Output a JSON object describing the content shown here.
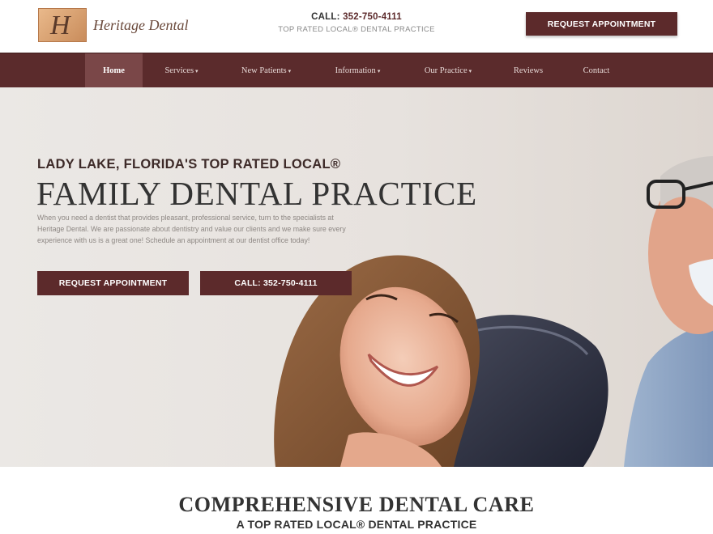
{
  "header": {
    "logo_text": "Heritage Dental",
    "logo_mark": "H",
    "call_label": "CALL:",
    "call_number": "352-750-4111",
    "tagline": "TOP RATED LOCAL® DENTAL PRACTICE",
    "appointment_button": "REQUEST APPOINTMENT"
  },
  "nav": {
    "items": [
      {
        "label": "Home",
        "active": true,
        "dropdown": false
      },
      {
        "label": "Services",
        "dropdown": true
      },
      {
        "label": "New Patients",
        "dropdown": true
      },
      {
        "label": "Information",
        "dropdown": true
      },
      {
        "label": "Our Practice",
        "dropdown": true
      },
      {
        "label": "Reviews",
        "dropdown": false
      },
      {
        "label": "Contact",
        "dropdown": false
      }
    ],
    "caret": "▾"
  },
  "hero": {
    "subtitle": "LADY LAKE, FLORIDA'S TOP RATED LOCAL®",
    "title": "FAMILY DENTAL PRACTICE",
    "text": "When you need a dentist that provides pleasant, professional service, turn to the specialists at Heritage Dental. We are passionate about dentistry and value our clients and we make sure every experience with us is a great one! Schedule an appointment at our dentist office today!",
    "appointment_button": "REQUEST APPOINTMENT",
    "call_button": "CALL: 352-750-4111"
  },
  "section": {
    "title": "COMPREHENSIVE DENTAL CARE",
    "subtitle": "A TOP RATED LOCAL® DENTAL PRACTICE"
  },
  "colors": {
    "brand": "#5c2a2b",
    "nav_active": "#7a4748",
    "hero_bg": "#e9e5e1"
  }
}
